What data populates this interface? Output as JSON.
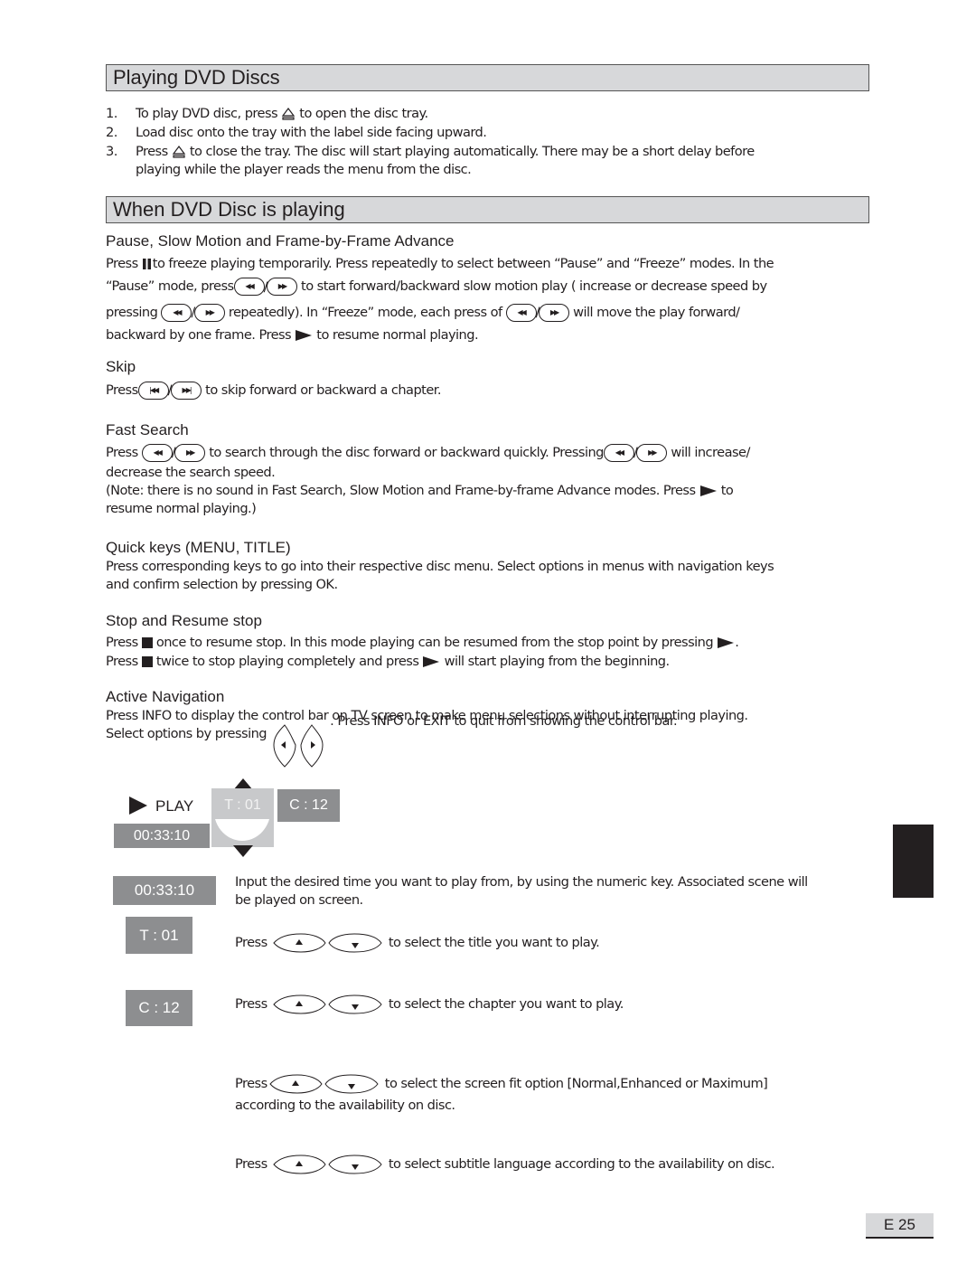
{
  "sections": {
    "playing": {
      "title": "Playing DVD Discs",
      "steps": [
        {
          "num": "1.",
          "pre": "To play DVD disc, press",
          "icon": "eject-icon",
          "post": "to open the disc tray."
        },
        {
          "num": "2.",
          "text": "Load disc onto the tray with the label side facing upward."
        },
        {
          "num": "3.",
          "pre": "Press",
          "icon": "eject-icon",
          "post": "to close the tray. The disc will start playing automatically. There may be a short delay before",
          "line2": "playing while the player reads the menu from the disc."
        }
      ]
    },
    "when_playing": {
      "title": "When DVD Disc is playing",
      "pause": {
        "heading": "Pause, Slow Motion and Frame-by-Frame Advance",
        "l1_a": "Press",
        "l1_b": "to freeze playing temporarily. Press repeatedly to select between “Pause” and “Freeze” modes. In the",
        "l2_a": "“Pause” mode, press",
        "l2_b": "to start forward/backward slow motion play ( increase or decrease speed by",
        "l3_a": "pressing",
        "l3_b": "repeatedly). In “Freeze” mode, each press of",
        "l3_c": "will move the play forward/",
        "l4_a": "backward by one frame. Press",
        "l4_b": "to resume normal playing."
      },
      "skip": {
        "heading": "Skip",
        "a": "Press",
        "b": "to skip forward or backward a chapter."
      },
      "fast_search": {
        "heading": "Fast Search",
        "l1_a": "Press",
        "l1_b": "to search through the disc forward or backward quickly.  Pressing",
        "l1_c": "will increase/",
        "l2": "decrease the search speed.",
        "l3_a": "(Note: there is no sound in Fast Search, Slow Motion and Frame-by-frame Advance modes.  Press",
        "l3_b": "to",
        "l4": "resume normal playing.)"
      },
      "quick_keys": {
        "heading": "Quick keys (MENU, TITLE)",
        "l1": "Press corresponding keys to go into their respective disc menu.  Select options in menus with navigation keys",
        "l2": "and confirm selection by pressing OK."
      },
      "stop": {
        "heading": "Stop and Resume stop",
        "l1_a": "Press",
        "l1_b": "once to resume stop. In this mode playing can be resumed from the stop point by pressing",
        "l1_c": ".",
        "l2_a": "Press",
        "l2_b": "twice to stop playing completely and press",
        "l2_c": "will start playing from the beginning."
      },
      "active_nav": {
        "heading": "Active Navigation",
        "l1": "Press INFO to display the control bar on TV screen to make menu selections without interrupting playing.",
        "l2_a": "Select options by pressing",
        "l2_b": ". Press  INFO or EXIT to quit from showing the control bar."
      }
    }
  },
  "control_bar": {
    "play_label": "PLAY",
    "time": "00:33:10",
    "title": "T : 01",
    "chapter": "C : 12"
  },
  "explanations": [
    {
      "badge": "00:33:10",
      "text1": "Input the desired time you want to play from, by using the numeric key. Associated scene will",
      "text2": "be played on screen."
    },
    {
      "badge": "T : 01",
      "pre": "Press",
      "text1": "to  select the title you want to play."
    },
    {
      "badge": "C : 12",
      "pre": "Press",
      "text1": "to select the chapter you want to play."
    },
    {
      "pre": "Press",
      "text1": "to  select the screen fit option [Normal,Enhanced or Maximum]",
      "text2": "according to the availability on disc."
    },
    {
      "pre": "Press",
      "text1": "to select subtitle language according to the availability on disc."
    }
  ],
  "separator": "/",
  "page_number": "E 25"
}
